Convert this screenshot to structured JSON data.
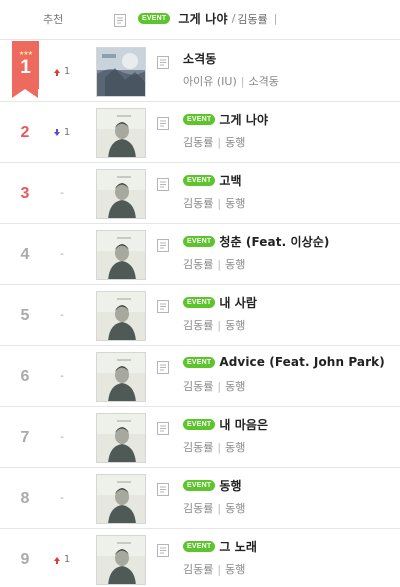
{
  "header": {
    "recommend_label": "추천",
    "now_playing": {
      "event_label": "EVENT",
      "song": "그게 나야",
      "separator": "/",
      "artist": "김동률",
      "trailing": "|"
    }
  },
  "rows": [
    {
      "rank": "1",
      "badge": true,
      "change_dir": "up",
      "change_val": "1",
      "event": false,
      "title": "소격동",
      "artist": "아이유 (IU)",
      "album": "소격동",
      "art": "a"
    },
    {
      "rank": "2",
      "badge": false,
      "change_dir": "down",
      "change_val": "1",
      "event": true,
      "title": "그게 나야",
      "artist": "김동률",
      "album": "동행",
      "art": "b"
    },
    {
      "rank": "3",
      "badge": false,
      "change_dir": "none",
      "change_val": "-",
      "event": true,
      "title": "고백",
      "artist": "김동률",
      "album": "동행",
      "art": "b"
    },
    {
      "rank": "4",
      "badge": false,
      "change_dir": "none",
      "change_val": "-",
      "event": true,
      "title": "청춘 (Feat. 이상순)",
      "artist": "김동률",
      "album": "동행",
      "art": "b"
    },
    {
      "rank": "5",
      "badge": false,
      "change_dir": "none",
      "change_val": "-",
      "event": true,
      "title": "내 사람",
      "artist": "김동률",
      "album": "동행",
      "art": "b"
    },
    {
      "rank": "6",
      "badge": false,
      "change_dir": "none",
      "change_val": "-",
      "event": true,
      "title": "Advice (Feat. John Park)",
      "artist": "김동률",
      "album": "동행",
      "art": "b"
    },
    {
      "rank": "7",
      "badge": false,
      "change_dir": "none",
      "change_val": "-",
      "event": true,
      "title": "내 마음은",
      "artist": "김동률",
      "album": "동행",
      "art": "b"
    },
    {
      "rank": "8",
      "badge": false,
      "change_dir": "none",
      "change_val": "-",
      "event": true,
      "title": "동행",
      "artist": "김동률",
      "album": "동행",
      "art": "b"
    },
    {
      "rank": "9",
      "badge": false,
      "change_dir": "up",
      "change_val": "1",
      "event": true,
      "title": "그 노래",
      "artist": "김동률",
      "album": "동행",
      "art": "b"
    }
  ],
  "icons": {
    "note": "lyrics-note-icon",
    "up": "rank-up-arrow-icon",
    "down": "rank-down-arrow-icon",
    "stars": "top-rank-stars-icon"
  },
  "colors": {
    "event_green": "#5ec42e",
    "rank_red": "#e8585b",
    "badge_red": "#ee6a5f",
    "up_red": "#e53a2f",
    "down_blue": "#5b4ad9"
  }
}
